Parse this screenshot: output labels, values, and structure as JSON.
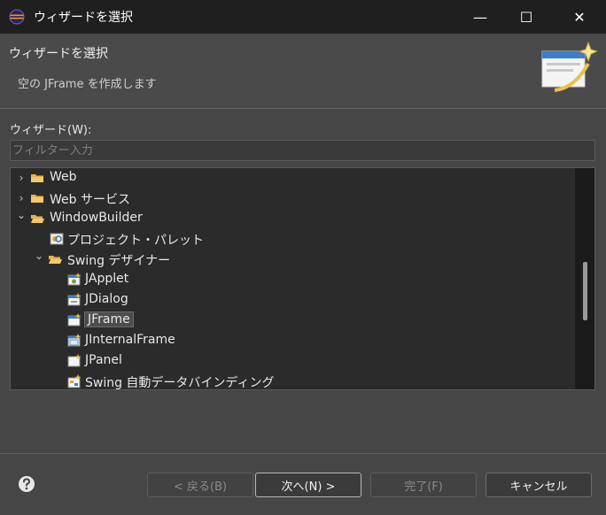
{
  "window": {
    "title": "ウィザードを選択",
    "minimize_glyph": "—",
    "maximize_glyph": "☐",
    "close_glyph": "✕"
  },
  "header": {
    "title": "ウィザードを選択",
    "description": "空の JFrame を作成します"
  },
  "wizard_label": "ウィザード(W):",
  "filter": {
    "placeholder": "フィルター入力",
    "value": ""
  },
  "tree": {
    "items": [
      {
        "label": "Web",
        "chevron": "›",
        "icon": "folder-icon"
      },
      {
        "label": "Web サービス",
        "chevron": "›",
        "icon": "folder-icon"
      },
      {
        "label": "WindowBuilder",
        "chevron": "⌄",
        "icon": "folder-open-icon"
      },
      {
        "label": "プロジェクト・パレット",
        "chevron": "",
        "icon": "palette-icon"
      },
      {
        "label": "Swing デザイナー",
        "chevron": "⌄",
        "icon": "folder-open-icon"
      },
      {
        "label": "JApplet",
        "chevron": "",
        "icon": "japplet-icon"
      },
      {
        "label": "JDialog",
        "chevron": "",
        "icon": "jdialog-icon"
      },
      {
        "label": "JFrame",
        "chevron": "",
        "icon": "jframe-icon",
        "selected": true
      },
      {
        "label": "JInternalFrame",
        "chevron": "",
        "icon": "jinternalframe-icon"
      },
      {
        "label": "JPanel",
        "chevron": "",
        "icon": "jpanel-icon"
      },
      {
        "label": "Swing 自動データバインディング",
        "chevron": "",
        "icon": "databinding-icon"
      }
    ]
  },
  "buttons": {
    "back": "< 戻る(B)",
    "next": "次へ(N) >",
    "finish": "完了(F)",
    "cancel": "キャンセル"
  },
  "help_icon": "help-icon",
  "colors": {
    "background": "#464646",
    "titlebar": "#1f1f1f",
    "tree_background": "#2b2b2b",
    "folder": "#e8b24a"
  }
}
